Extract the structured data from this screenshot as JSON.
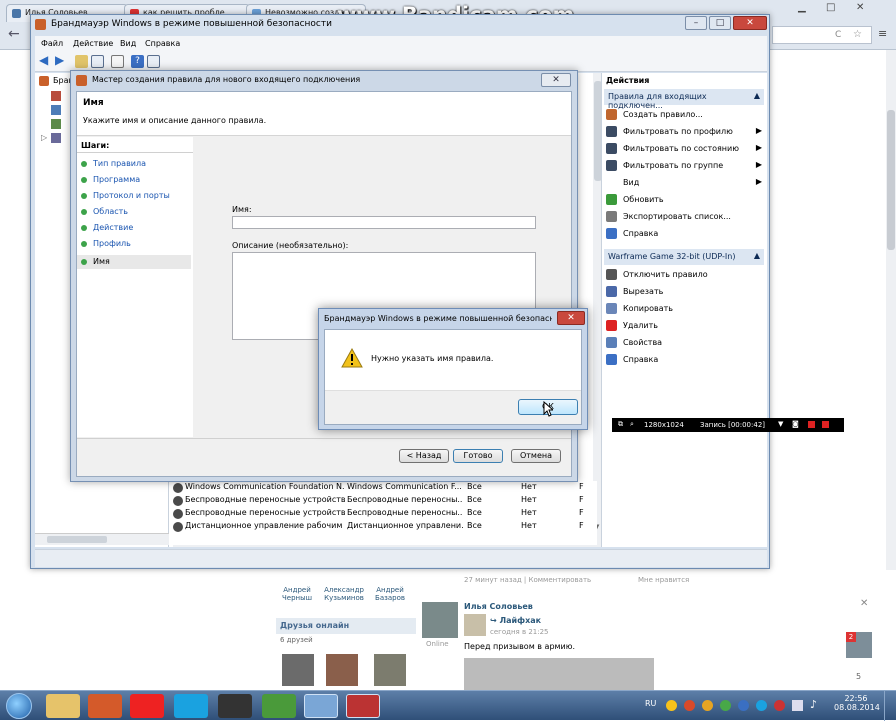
{
  "watermark": "www.Bandicam.com",
  "browser": {
    "tabs": [
      {
        "label": "Илья Соловьев",
        "color": "#4a76a8"
      },
      {
        "label": "как решить пробле",
        "color": "#d33"
      },
      {
        "label": "Невозможно создан",
        "color": "#6aa0d8"
      }
    ],
    "address_suffix": "С"
  },
  "mmc": {
    "title": "Брандмауэр Windows в режиме повышенной безопасности",
    "menu": [
      "Файл",
      "Действие",
      "Вид",
      "Справка"
    ],
    "tree_root": "Бранд",
    "status_text": ""
  },
  "actions_pane": {
    "header": "Действия",
    "section1": "Правила для входящих подключен...",
    "items1": [
      {
        "label": "Создать правило...",
        "icon": "new-rule-icon",
        "arrow": false
      },
      {
        "label": "Фильтровать по профилю",
        "icon": "filter-icon",
        "arrow": true
      },
      {
        "label": "Фильтровать по состоянию",
        "icon": "filter-icon",
        "arrow": true
      },
      {
        "label": "Фильтровать по группе",
        "icon": "filter-icon",
        "arrow": true
      },
      {
        "label": "Вид",
        "icon": "",
        "arrow": true
      },
      {
        "label": "Обновить",
        "icon": "refresh-icon",
        "arrow": false
      },
      {
        "label": "Экспортировать список...",
        "icon": "export-icon",
        "arrow": false
      },
      {
        "label": "Справка",
        "icon": "help-icon",
        "arrow": false
      }
    ],
    "section2": "Warframe Game 32-bit (UDP-In)",
    "items2": [
      {
        "label": "Отключить правило",
        "icon": "disable-icon"
      },
      {
        "label": "Вырезать",
        "icon": "cut-icon"
      },
      {
        "label": "Копировать",
        "icon": "copy-icon"
      },
      {
        "label": "Удалить",
        "icon": "delete-icon"
      },
      {
        "label": "Свойства",
        "icon": "properties-icon"
      },
      {
        "label": "Справка",
        "icon": "help-icon"
      }
    ]
  },
  "rules": [
    {
      "name": "Windows Communication Foundation N...",
      "group": "Windows Communication F...",
      "profile": "Все",
      "enabled": "Нет",
      "action": "F"
    },
    {
      "name": "Беспроводные переносные устройства...",
      "group": "Беспроводные переносны...",
      "profile": "Все",
      "enabled": "Нет",
      "action": "F"
    },
    {
      "name": "Беспроводные переносные устройства...",
      "group": "Беспроводные переносны...",
      "profile": "Все",
      "enabled": "Нет",
      "action": "F"
    },
    {
      "name": "Дистанционное управление рабочим с...",
      "group": "Дистанционное управлени...",
      "profile": "Все",
      "enabled": "Нет",
      "action": "F"
    }
  ],
  "wizard": {
    "title": "Мастер создания правила для нового входящего подключения",
    "page_title": "Имя",
    "page_subtitle": "Укажите имя и описание данного правила.",
    "steps_header": "Шаги:",
    "steps": [
      "Тип правила",
      "Программа",
      "Протокол и порты",
      "Область",
      "Действие",
      "Профиль",
      "Имя"
    ],
    "name_label": "Имя:",
    "name_value": "",
    "desc_label": "Описание (необязательно):",
    "desc_value": "",
    "back_button": "< Назад",
    "finish_button": "Готово",
    "cancel_button": "Отмена"
  },
  "msgbox": {
    "title": "Брандмауэр Windows в режиме повышенной безопасно...",
    "message": "Нужно указать имя правила.",
    "ok_button": "ОК"
  },
  "bandicam": {
    "resolution": "1280x1024",
    "recording": "Запись [00:00:42]"
  },
  "vk": {
    "friends": [
      {
        "first": "Андрей",
        "last": "Черныш"
      },
      {
        "first": "Александр",
        "last": "Кузьминов"
      },
      {
        "first": "Андрей",
        "last": "Базаров"
      }
    ],
    "post_meta": "27 минут назад | Комментировать",
    "post_likes": "Мне нравится",
    "online_header": "Друзья онлайн",
    "online_count": "6 друзей",
    "user_name": "Илья Соловьев",
    "user_status": "Online",
    "repost_name": "Лайфхак",
    "repost_time": "сегодня в 21:25",
    "repost_text": "Перед призывом в армию.",
    "badge": "2",
    "side_num": "5"
  },
  "taskbar": {
    "lang": "RU",
    "time": "22:56",
    "date": "08.08.2014"
  }
}
